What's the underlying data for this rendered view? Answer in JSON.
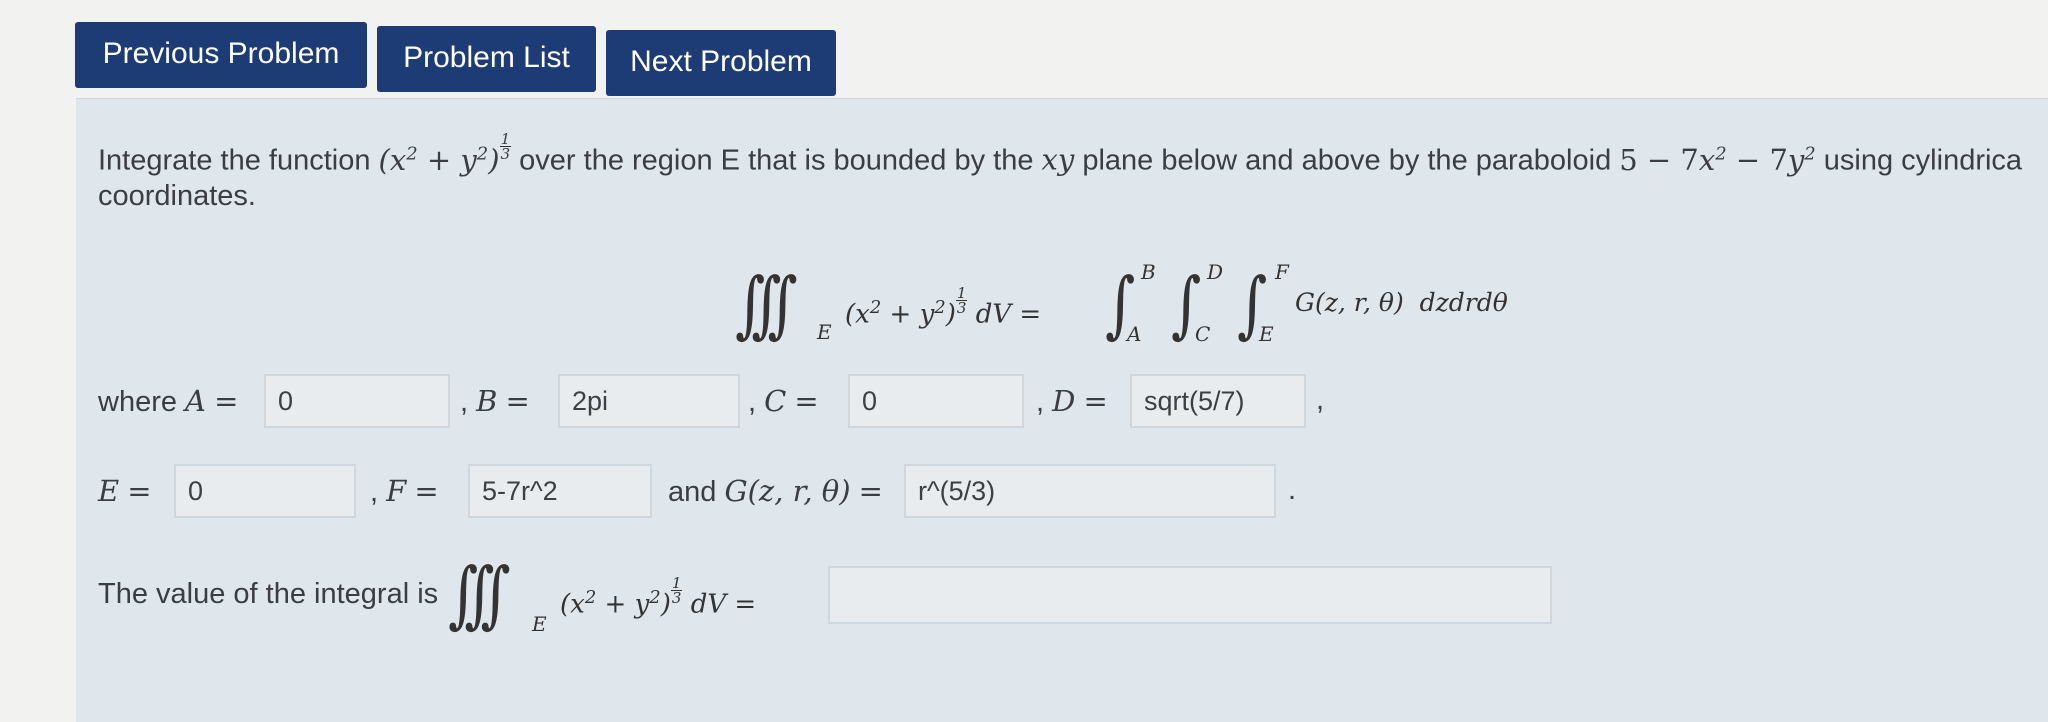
{
  "nav": {
    "prev_label": "Previous Problem",
    "list_label": "Problem List",
    "next_label": "Next Problem"
  },
  "problem": {
    "intro_before": "Integrate the function ",
    "intro_after": " over the region E that is bounded by the ",
    "intro_plane": "xy",
    "intro_after2": " plane below and above by the paraboloid ",
    "intro_tail": " using cylindrica",
    "intro_line2": "coordinates.",
    "region_letter": "E"
  },
  "labels": {
    "where": "where ",
    "and": "and "
  },
  "answers": {
    "A": "0",
    "B": "2pi",
    "C": "0",
    "D": "sqrt(5/7)",
    "E": "0",
    "F": "5-7r^2",
    "G": "r^(5/3)",
    "integral_value": ""
  },
  "value_prompt": "The value of the integral is"
}
